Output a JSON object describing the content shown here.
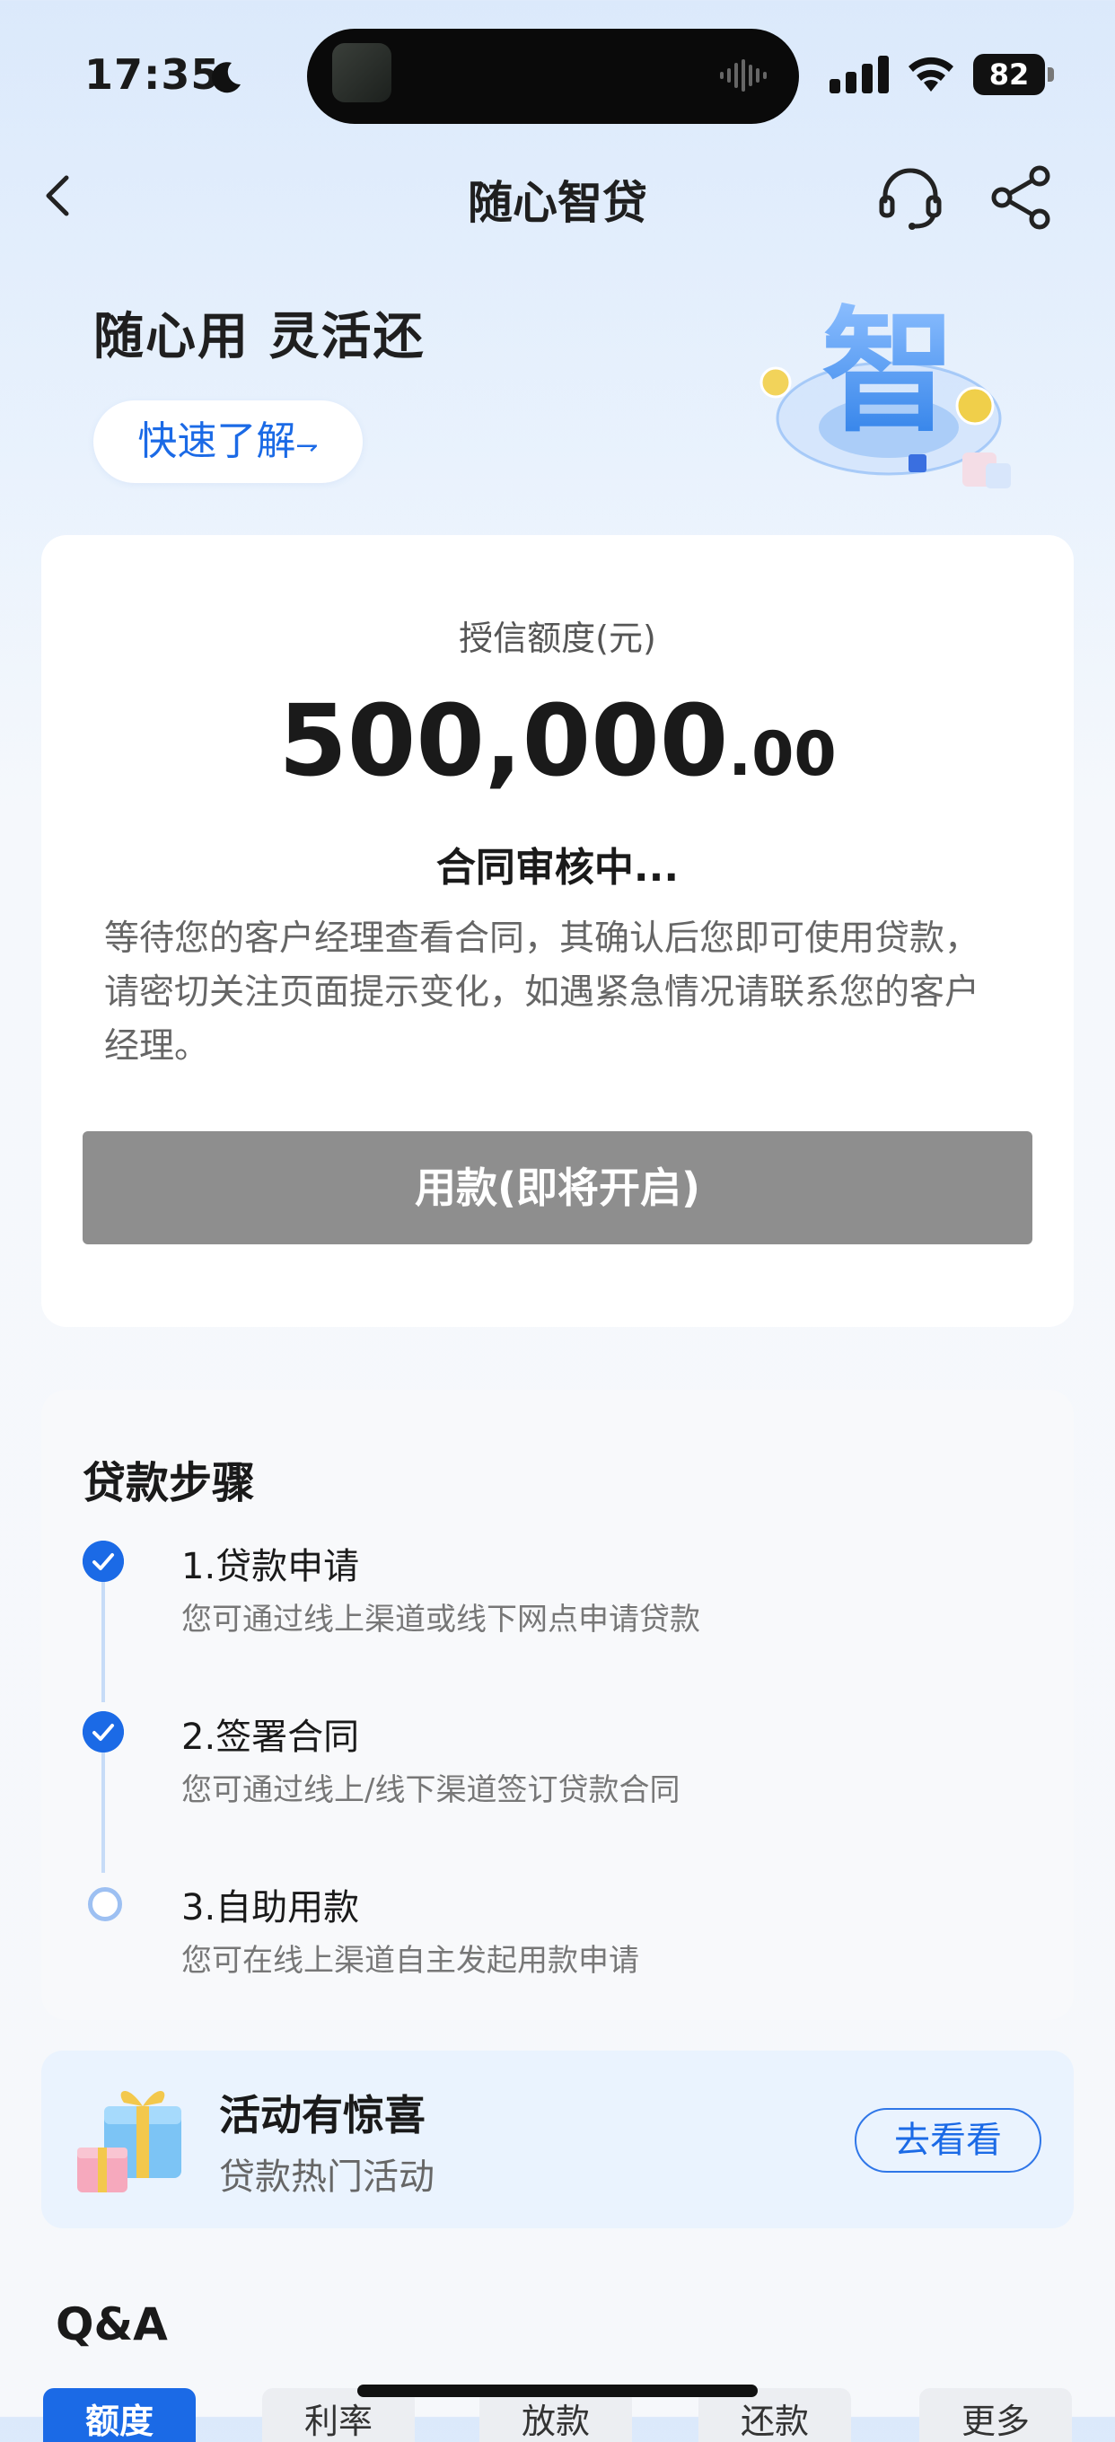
{
  "status_bar": {
    "time": "17:35",
    "battery": "82",
    "icons": [
      "moon-icon",
      "signal-icon",
      "wifi-icon",
      "battery-icon"
    ]
  },
  "nav": {
    "title": "随心智贷",
    "icons": [
      "back-icon",
      "headset-icon",
      "share-icon"
    ]
  },
  "hero": {
    "slogan": "随心用 灵活还",
    "learn_button": "快速了解",
    "art_glyph": "智"
  },
  "credit": {
    "label": "授信额度(元)",
    "amount_int": "500,000",
    "amount_dec": ".00",
    "status": "合同审核中...",
    "description": "等待您的客户经理查看合同，其确认后您即可使用贷款，请密切关注页面提示变化，如遇紧急情况请联系您的客户经理。",
    "use_button": "用款(即将开启)"
  },
  "steps": {
    "title": "贷款步骤",
    "items": [
      {
        "title": "1.贷款申请",
        "desc": "您可通过线上渠道或线下网点申请贷款",
        "state": "done"
      },
      {
        "title": "2.签署合同",
        "desc": "您可通过线上/线下渠道签订贷款合同",
        "state": "done"
      },
      {
        "title": "3.自助用款",
        "desc": "您可在线上渠道自主发起用款申请",
        "state": "pending"
      }
    ]
  },
  "activity": {
    "title": "活动有惊喜",
    "subtitle": "贷款热门活动",
    "button": "去看看"
  },
  "qa": {
    "title": "Q&A",
    "tabs": [
      "额度",
      "利率",
      "放款",
      "还款",
      "更多"
    ],
    "active_tab": "额度"
  },
  "colors": {
    "accent": "#1b6ae6",
    "disabled_button": "#8e8e8e",
    "step_line": "#c7dcf7"
  }
}
